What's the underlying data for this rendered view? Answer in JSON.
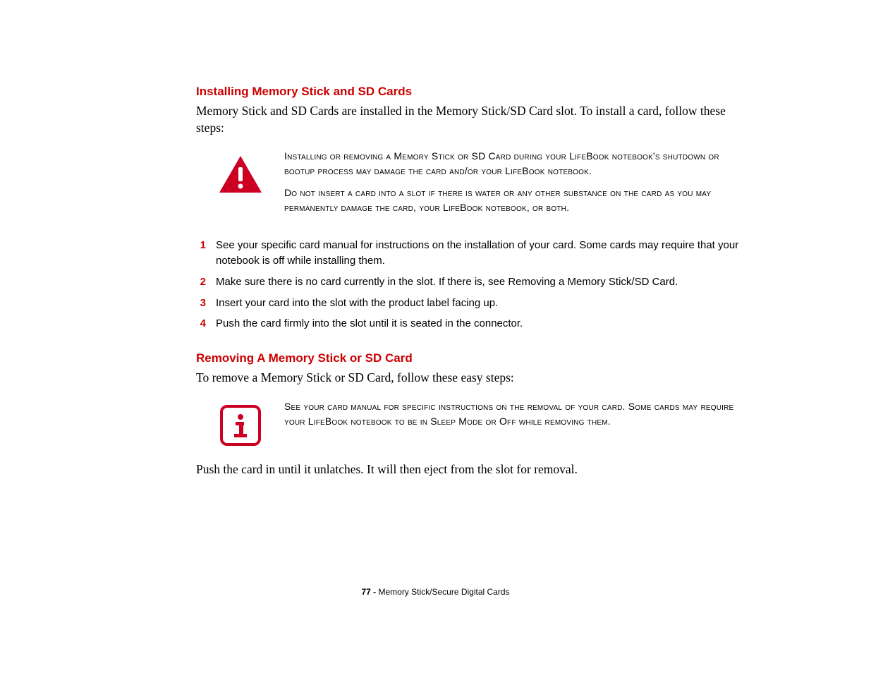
{
  "section1": {
    "heading": "Installing Memory Stick and SD Cards",
    "intro": "Memory Stick and SD Cards are installed in the Memory Stick/SD Card slot. To install a card, follow these steps:",
    "warning_p1": "Installing or removing a Memory Stick or SD Card during your LifeBook notebook's shutdown or bootup process may damage the card and/or your LifeBook notebook.",
    "warning_p2": "Do not insert a card into a slot if there is water or any other substance on the card as you may permanently damage the card, your LifeBook notebook, or both.",
    "steps": [
      "See your specific card manual for instructions on the installation of your card. Some cards may require that your notebook is off while installing them.",
      "Make sure there is no card currently in the slot. If there is, see Removing a Memory Stick/SD Card.",
      "Insert your card into the slot with the product label facing up.",
      "Push the card firmly into the slot until it is seated in the connector."
    ]
  },
  "section2": {
    "heading": "Removing A Memory Stick or SD Card",
    "intro": "To remove a Memory Stick or SD Card, follow these easy steps:",
    "info": "See your card manual for specific instructions on the removal of your card. Some cards may require your LifeBook notebook to be in Sleep Mode or Off while removing them.",
    "body": "Push the card in until it unlatches. It will then eject from the slot for removal."
  },
  "footer": {
    "page": "77 -",
    "title": " Memory Stick/Secure Digital Cards"
  },
  "step_numbers": [
    "1",
    "2",
    "3",
    "4"
  ]
}
